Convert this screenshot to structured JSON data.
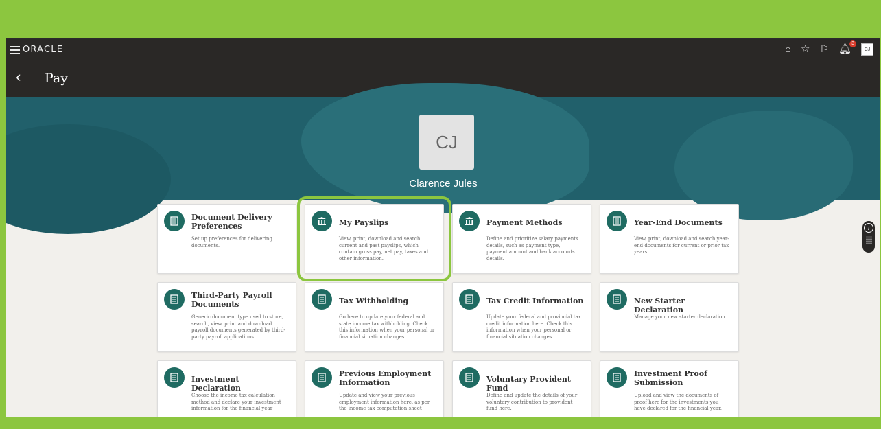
{
  "brand": {
    "logo_text": "ORACLE"
  },
  "header": {
    "page_title": "Pay",
    "back_glyph": "‹",
    "notifications_badge": "3",
    "user_initials": "CJ"
  },
  "profile": {
    "initials": "CJ",
    "name": "Clarence Jules"
  },
  "cards": [
    {
      "title": "Document Delivery Preferences",
      "desc": "Set up preferences for delivering documents.",
      "icon": "document-icon"
    },
    {
      "title": "My Payslips",
      "desc": "View, print, download and search current and past payslips, which contain gross pay, net pay, taxes and other information.",
      "icon": "bank-icon"
    },
    {
      "title": "Payment Methods",
      "desc": "Define and prioritize salary payments details, such as payment type, payment amount and bank accounts details.",
      "icon": "bank-icon"
    },
    {
      "title": "Year-End Documents",
      "desc": "View, print, download and search year-end documents for current or prior tax years.",
      "icon": "document-icon"
    },
    {
      "title": "Third-Party Payroll Documents",
      "desc": "Generic document type used to store, search, view, print and download payroll documents generated by third-party payroll applications.",
      "icon": "document-icon"
    },
    {
      "title": "Tax Withholding",
      "desc": "Go here to update your federal and state income tax withholding. Check this information when your personal or financial situation changes.",
      "icon": "document-icon"
    },
    {
      "title": "Tax Credit Information",
      "desc": "Update your federal and provincial tax credit information here. Check this information when your personal or financial situation changes.",
      "icon": "document-icon"
    },
    {
      "title": "New Starter Declaration",
      "desc": "Manage your new starter declaration.",
      "icon": "document-icon"
    },
    {
      "title": "Investment Declaration",
      "desc": "Choose the income tax calculation method and declare your investment information for the financial year",
      "icon": "document-icon"
    },
    {
      "title": "Previous Employment Information",
      "desc": "Update and view your previous employment information here, as per the income tax computation sheet",
      "icon": "document-icon"
    },
    {
      "title": "Voluntary Provident Fund",
      "desc": "Define and update the details of your voluntary contribution to provident fund here.",
      "icon": "document-icon"
    },
    {
      "title": "Investment Proof Submission",
      "desc": "Upload and view the documents of proof here for the investments you have declared for the financial year.",
      "icon": "document-icon"
    }
  ],
  "colors": {
    "accent_green": "#8cc63f",
    "header_bg": "#2a2826",
    "hero_teal": "#21606b",
    "icon_teal": "#1f6b62"
  }
}
